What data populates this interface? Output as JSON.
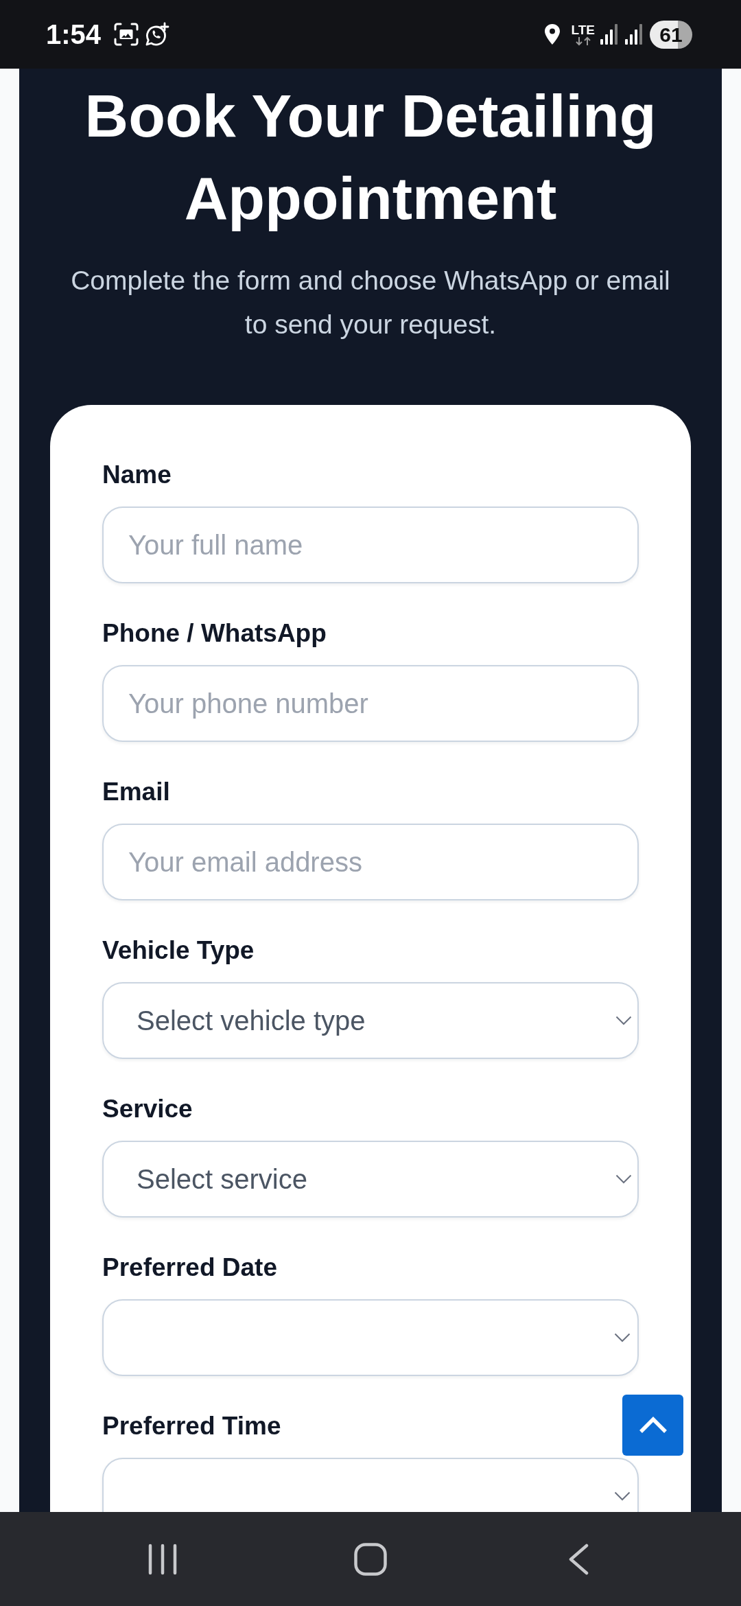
{
  "status_bar": {
    "time": "1:54",
    "network": "LTE",
    "battery": "61"
  },
  "header": {
    "title": "Book Your Detailing Appointment",
    "subtitle": "Complete the form and choose WhatsApp or email to send your request."
  },
  "form": {
    "fields": [
      {
        "label": "Name",
        "kind": "text",
        "placeholder": "Your full name"
      },
      {
        "label": "Phone / WhatsApp",
        "kind": "text",
        "placeholder": "Your phone number"
      },
      {
        "label": "Email",
        "kind": "text",
        "placeholder": "Your email address"
      },
      {
        "label": "Vehicle Type",
        "kind": "select",
        "value": "Select vehicle type"
      },
      {
        "label": "Service",
        "kind": "select",
        "value": "Select service"
      },
      {
        "label": "Preferred Date",
        "kind": "date"
      },
      {
        "label": "Preferred Time",
        "kind": "time"
      }
    ]
  }
}
